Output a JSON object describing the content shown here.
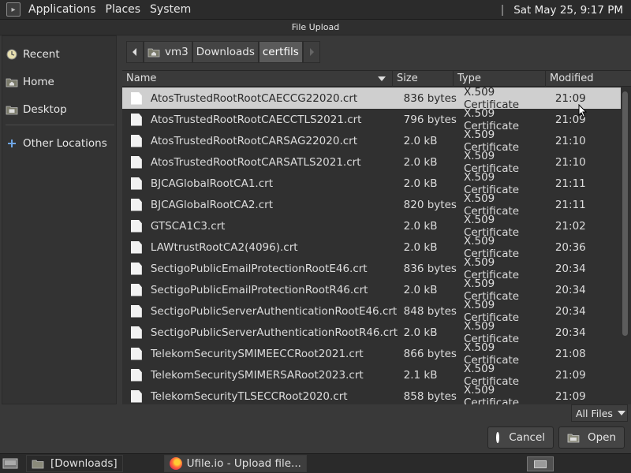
{
  "top_panel": {
    "menus": [
      "Applications",
      "Places",
      "System"
    ],
    "clock": "Sat May 25,  9:17 PM"
  },
  "dialog": {
    "title": "File Upload",
    "sidebar": [
      {
        "label": "Recent",
        "icon": "clock-icon"
      },
      {
        "label": "Home",
        "icon": "home-folder-icon"
      },
      {
        "label": "Desktop",
        "icon": "desktop-folder-icon"
      },
      {
        "label": "Other Locations",
        "icon": "plus-icon"
      }
    ],
    "path": [
      "vm3",
      "Downloads",
      "certfils"
    ],
    "columns": {
      "name": "Name",
      "size": "Size",
      "type": "Type",
      "modified": "Modified"
    },
    "files": [
      {
        "name": "AtosTrustedRootRootCAECCG22020.crt",
        "size": "836 bytes",
        "type": "X.509 Certificate",
        "modified": "21:09"
      },
      {
        "name": "AtosTrustedRootRootCAECCTLS2021.crt",
        "size": "796 bytes",
        "type": "X.509 Certificate",
        "modified": "21:09"
      },
      {
        "name": "AtosTrustedRootRootCARSAG22020.crt",
        "size": "2.0 kB",
        "type": "X.509 Certificate",
        "modified": "21:10"
      },
      {
        "name": "AtosTrustedRootRootCARSATLS2021.crt",
        "size": "2.0 kB",
        "type": "X.509 Certificate",
        "modified": "21:10"
      },
      {
        "name": "BJCAGlobalRootCA1.crt",
        "size": "2.0 kB",
        "type": "X.509 Certificate",
        "modified": "21:11"
      },
      {
        "name": "BJCAGlobalRootCA2.crt",
        "size": "820 bytes",
        "type": "X.509 Certificate",
        "modified": "21:11"
      },
      {
        "name": "GTSCA1C3.crt",
        "size": "2.0 kB",
        "type": "X.509 Certificate",
        "modified": "21:02"
      },
      {
        "name": "LAWtrustRootCA2(4096).crt",
        "size": "2.0 kB",
        "type": "X.509 Certificate",
        "modified": "20:36"
      },
      {
        "name": "SectigoPublicEmailProtectionRootE46.crt",
        "size": "836 bytes",
        "type": "X.509 Certificate",
        "modified": "20:34"
      },
      {
        "name": "SectigoPublicEmailProtectionRootR46.crt",
        "size": "2.0 kB",
        "type": "X.509 Certificate",
        "modified": "20:34"
      },
      {
        "name": "SectigoPublicServerAuthenticationRootE46.crt",
        "size": "848 bytes",
        "type": "X.509 Certificate",
        "modified": "20:34"
      },
      {
        "name": "SectigoPublicServerAuthenticationRootR46.crt",
        "size": "2.0 kB",
        "type": "X.509 Certificate",
        "modified": "20:34"
      },
      {
        "name": "TelekomSecuritySMIMEECCRoot2021.crt",
        "size": "866 bytes",
        "type": "X.509 Certificate",
        "modified": "21:08"
      },
      {
        "name": "TelekomSecuritySMIMERSARoot2023.crt",
        "size": "2.1 kB",
        "type": "X.509 Certificate",
        "modified": "21:09"
      },
      {
        "name": "TelekomSecurityTLSECCRoot2020.crt",
        "size": "858 bytes",
        "type": "X.509 Certificate",
        "modified": "21:09"
      }
    ],
    "selected_index": 0,
    "filter": "All Files",
    "cancel_label": "Cancel",
    "open_label": "Open"
  },
  "taskbar": {
    "items": [
      "[Downloads]",
      "Ufile.io - Upload file..."
    ]
  },
  "colors": {
    "selection": "#cfcfcf",
    "cancel_red": "#d8202a"
  }
}
